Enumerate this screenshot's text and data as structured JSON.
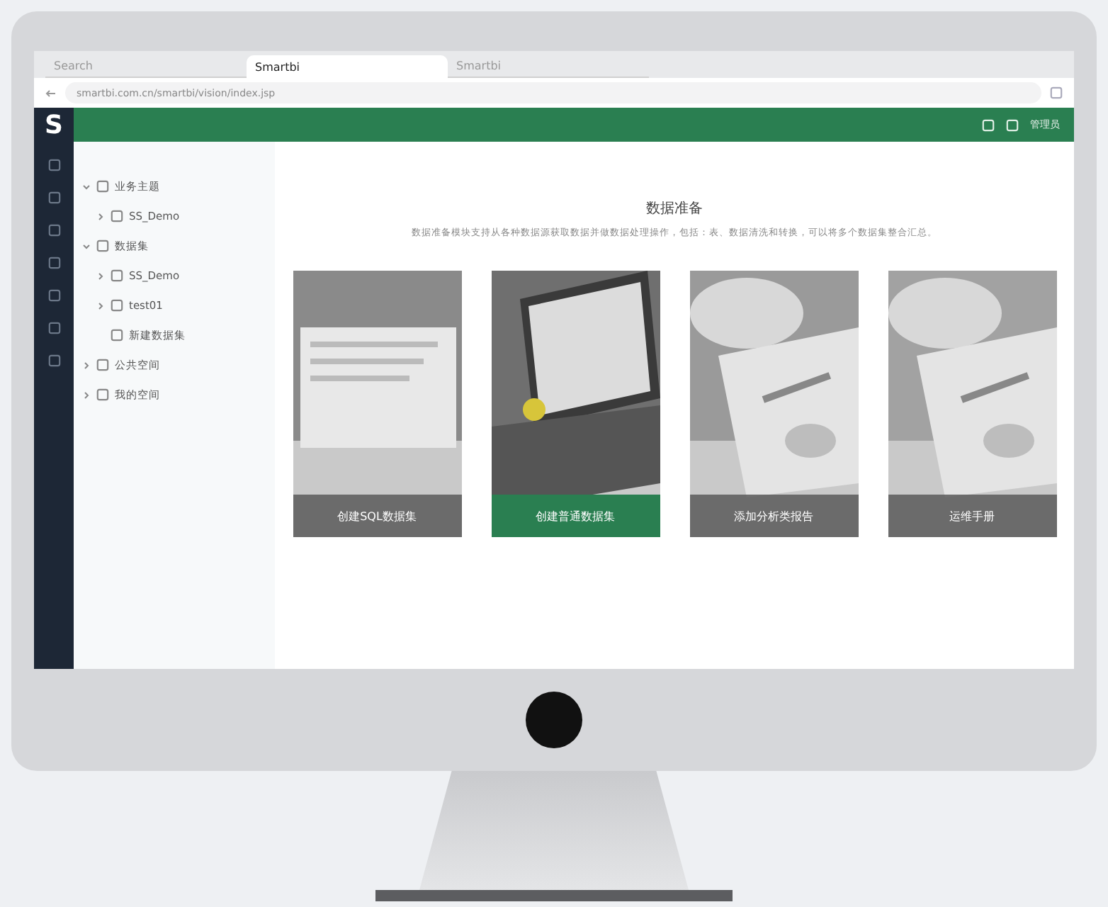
{
  "browser": {
    "tabs": [
      {
        "label": "Search",
        "selected": false
      },
      {
        "label": "Smartbi",
        "selected": true
      },
      {
        "label": "Smartbi",
        "selected": false
      }
    ],
    "url": "smartbi.com.cn/smartbi/vision/index.jsp"
  },
  "app": {
    "logo": "S",
    "user": "管理员"
  },
  "tree": [
    {
      "label": "业务主题",
      "expanded": true,
      "children": [
        {
          "label": "SS_Demo",
          "expanded": false
        }
      ]
    },
    {
      "label": "数据集",
      "expanded": true,
      "children": [
        {
          "label": "SS_Demo",
          "expanded": false
        },
        {
          "label": "test01",
          "expanded": false
        },
        {
          "label": "新建数据集"
        }
      ]
    },
    {
      "label": "公共空间",
      "expanded": false
    },
    {
      "label": "我的空间",
      "expanded": false
    }
  ],
  "content": {
    "title": "数据准备",
    "description": "数据准备模块支持从各种数据源获取数据并做数据处理操作，包括：表、数据清洗和转换，可以将多个数据集整合汇总。"
  },
  "cards": [
    {
      "label": "创建SQL数据集",
      "selected": false
    },
    {
      "label": "创建普通数据集",
      "selected": true
    },
    {
      "label": "添加分析类报告",
      "selected": false
    },
    {
      "label": "运维手册",
      "selected": false
    }
  ]
}
